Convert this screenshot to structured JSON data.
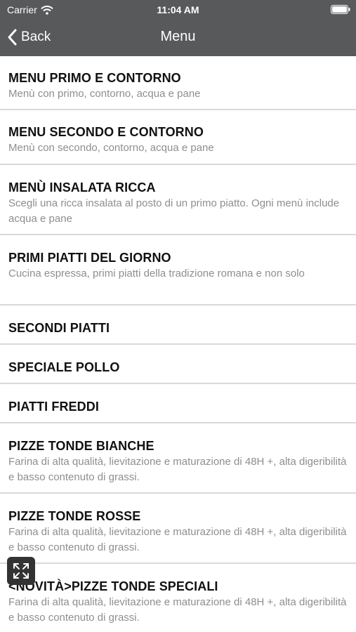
{
  "status_bar": {
    "carrier": "Carrier",
    "time": "11:04 AM"
  },
  "nav": {
    "back_label": "Back",
    "title": "Menu"
  },
  "menu_items": [
    {
      "title": "MENU PRIMO E CONTORNO",
      "description": "Menù con primo, contorno, acqua e pane"
    },
    {
      "title": "MENU SECONDO E CONTORNO",
      "description": "Menù con secondo, contorno, acqua e pane"
    },
    {
      "title": "MENÙ INSALATA RICCA",
      "description": "Scegli una ricca insalata al posto di un primo piatto. Ogni menù include acqua e pane"
    },
    {
      "title": "PRIMI PIATTI DEL GIORNO",
      "description": "Cucina espressa, primi piatti della tradizione romana e non solo"
    },
    {
      "title": "SECONDI PIATTI",
      "description": ""
    },
    {
      "title": "SPECIALE POLLO",
      "description": ""
    },
    {
      "title": "PIATTI FREDDI",
      "description": ""
    },
    {
      "title": "PIZZE TONDE BIANCHE",
      "description": "Farina di alta qualità, lievitazione e maturazione di 48H +, alta digeribilità e basso contenuto di grassi."
    },
    {
      "title": "PIZZE TONDE ROSSE",
      "description": "Farina di alta qualità, lievitazione e maturazione di 48H +, alta digeribilità e basso contenuto di grassi."
    },
    {
      "title": "<NOVITÀ>PIZZE TONDE SPECIALI",
      "description": "Farina di alta qualità, lievitazione e maturazione di 48H +, alta digeribilità e basso contenuto di grassi."
    }
  ],
  "icons": {
    "wifi": "wifi-icon",
    "battery": "battery-icon",
    "back": "chevron-left-icon",
    "expand": "expand-icon"
  },
  "colors": {
    "navbar": "#58595b",
    "divider": "#d9d9d9",
    "title_text": "#111111",
    "description_text": "#8e8e8e"
  }
}
